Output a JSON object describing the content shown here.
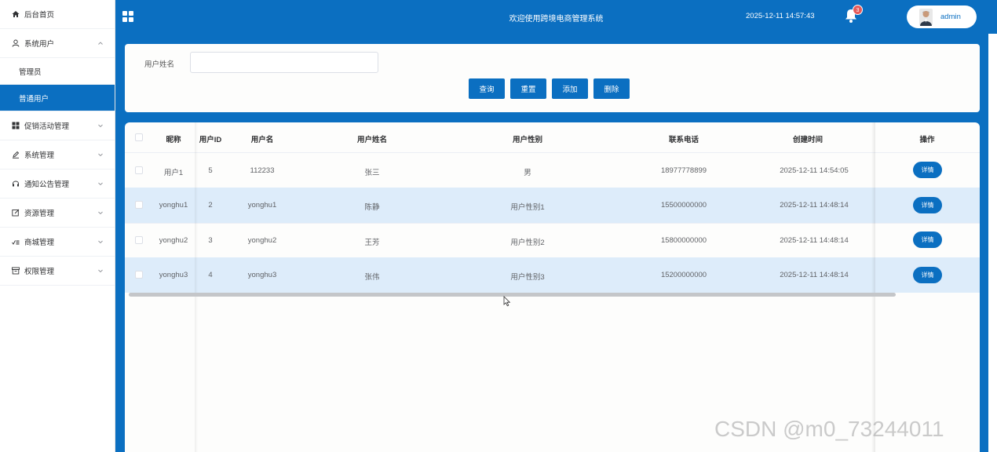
{
  "sidebar": {
    "items": [
      {
        "label": "后台首页",
        "icon": "home-icon"
      },
      {
        "label": "系统用户",
        "icon": "user-icon"
      },
      {
        "label": "管理员"
      },
      {
        "label": "普通用户"
      },
      {
        "label": "促销活动管理",
        "icon": "grid-icon"
      },
      {
        "label": "系统管理",
        "icon": "edit-icon"
      },
      {
        "label": "通知公告管理",
        "icon": "headset-icon"
      },
      {
        "label": "资源管理",
        "icon": "edit-box-icon"
      },
      {
        "label": "商城管理",
        "icon": "check-list-icon"
      },
      {
        "label": "权限管理",
        "icon": "archive-icon"
      }
    ]
  },
  "header": {
    "title": "欢迎使用跨境电商管理系统",
    "datetime": "2025-12-11 14:57:43",
    "notification_count": "3",
    "username": "admin"
  },
  "search": {
    "label": "用户姓名",
    "value": "",
    "buttons": {
      "query": "查询",
      "reset": "重置",
      "add": "添加",
      "delete": "删除"
    }
  },
  "table": {
    "columns": [
      "昵称",
      "用户ID",
      "用户名",
      "用户姓名",
      "用户性别",
      "联系电话",
      "创建时间",
      "操作"
    ],
    "rows": [
      {
        "nickname": "用户1",
        "id": "5",
        "username": "112233",
        "realname": "张三",
        "gender": "男",
        "phone": "18977778899",
        "created": "2025-12-11 14:54:05",
        "action": "详情"
      },
      {
        "nickname": "yonghu1",
        "id": "2",
        "username": "yonghu1",
        "realname": "陈静",
        "gender": "用户性别1",
        "phone": "15500000000",
        "created": "2025-12-11 14:48:14",
        "action": "详情"
      },
      {
        "nickname": "yonghu2",
        "id": "3",
        "username": "yonghu2",
        "realname": "王芳",
        "gender": "用户性别2",
        "phone": "15800000000",
        "created": "2025-12-11 14:48:14",
        "action": "详情"
      },
      {
        "nickname": "yonghu3",
        "id": "4",
        "username": "yonghu3",
        "realname": "张伟",
        "gender": "用户性别3",
        "phone": "15200000000",
        "created": "2025-12-11 14:48:14",
        "action": "详情"
      }
    ]
  },
  "watermark": "CSDN @m0_73244011",
  "colors": {
    "primary": "#0b6fc1",
    "row_highlight": "#ddecfa",
    "badge": "#e65a5a"
  }
}
